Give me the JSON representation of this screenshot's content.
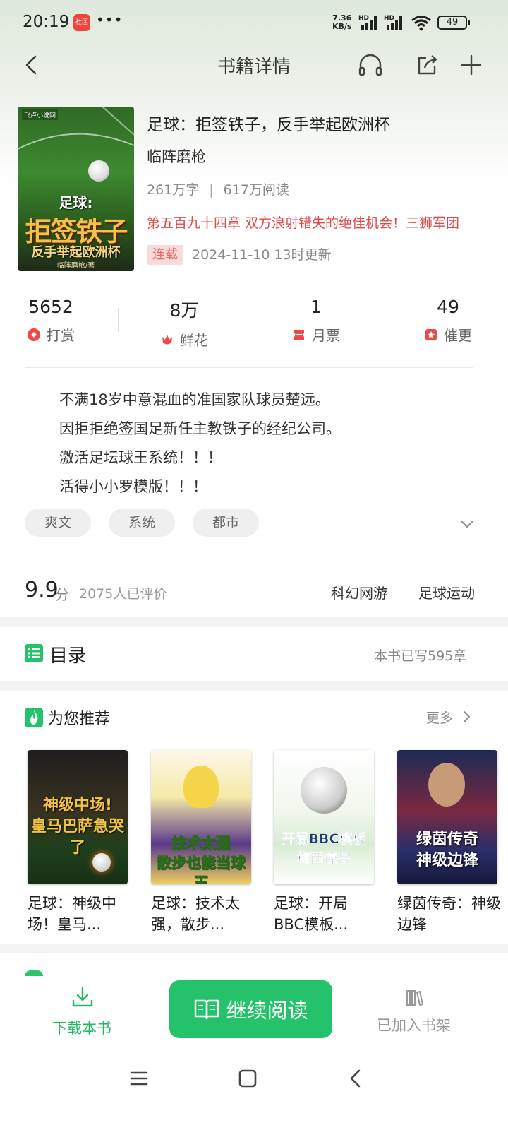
{
  "status": {
    "time": "20:19",
    "app_badge": "社区",
    "more": "•••",
    "speed_value": "7.36",
    "speed_unit": "KB/s",
    "hd1": "HD",
    "hd2": "HD",
    "battery": "49"
  },
  "nav": {
    "title": "书籍详情"
  },
  "cover": {
    "publisher": "飞卢小说网",
    "line1": "足球:",
    "line2": "拒签铁子",
    "line3": "反手举起欧洲杯",
    "line4": "临阵磨枪/著"
  },
  "book": {
    "title": "足球：拒签铁子，反手举起欧洲杯",
    "author": "临阵磨枪",
    "word_count": "261万字",
    "separator": "|",
    "reads": "617万阅读",
    "latest_chapter": "第五百九十四章 双方浪射错失的绝佳机会！三狮军团",
    "status_badge": "连载",
    "updated": "2024-11-10 13时更新"
  },
  "stats": [
    {
      "value": "5652",
      "label": "打赏"
    },
    {
      "value": "8万",
      "label": "鲜花"
    },
    {
      "value": "1",
      "label": "月票"
    },
    {
      "value": "49",
      "label": "催更"
    }
  ],
  "description": [
    "不满18岁中意混血的准国家队球员楚远。",
    "因拒拒绝签国足新任主教铁子的经纪公司。",
    "激活足坛球王系统！！！",
    "活得小小罗模版！！！"
  ],
  "tags": [
    "爽文",
    "系统",
    "都市"
  ],
  "rating": {
    "score": "9.9",
    "unit": "分",
    "count": "2075人已评价",
    "genres": [
      "科幻网游",
      "足球运动"
    ]
  },
  "toc": {
    "title": "目录",
    "count": "本书已写595章"
  },
  "recommend": {
    "title": "为您推荐",
    "more": "更多",
    "books": [
      {
        "name": "足球：神级中场！皇马...",
        "cover_text": "神级中场!\n皇马巴萨急哭了"
      },
      {
        "name": "足球：技术太强，散步...",
        "cover_text": "技术太强\n散步也能当球王"
      },
      {
        "name": "足球：开局BBC模板...",
        "cover_text": "开局BBC模板\n梅西惊呆"
      },
      {
        "name": "绿茵传奇：神级边锋",
        "cover_text": "绿茵传奇\n神级边锋"
      }
    ]
  },
  "bottom": {
    "download": "下载本书",
    "read": "继续阅读",
    "shelf": "已加入书架"
  },
  "colors": {
    "accent_green": "#24c26a",
    "latest_red": "#e04848",
    "badge_bg": "#fadada"
  }
}
